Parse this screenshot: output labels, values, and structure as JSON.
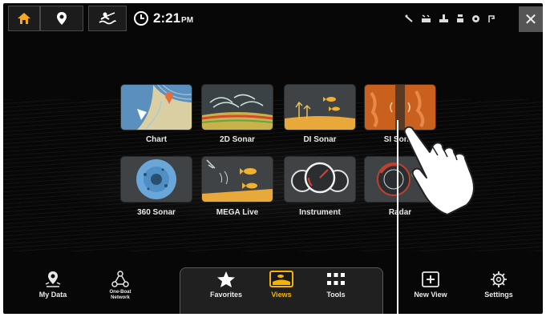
{
  "topbar": {
    "home_icon": "home-icon",
    "pin_icon": "map-pin-icon",
    "fish_icon": "fishing-person-icon",
    "time": "2:21",
    "ampm": "PM",
    "status_icons": [
      "gps-icon",
      "battery-icon",
      "water-temp-icon",
      "sonar-icon",
      "record-icon",
      "nmea-icon"
    ],
    "close_label": "✕"
  },
  "views": [
    {
      "label": "Chart"
    },
    {
      "label": "2D Sonar"
    },
    {
      "label": "DI Sonar"
    },
    {
      "label": "SI Sonar"
    },
    {
      "label": "360 Sonar"
    },
    {
      "label": "MEGA Live"
    },
    {
      "label": "Instrument"
    },
    {
      "label": "Radar"
    }
  ],
  "bottom_nav": {
    "my_data": "My Data",
    "one_boat_line1": "One-Boat",
    "one_boat_line2": "Network",
    "favorites": "Favorites",
    "views": "Views",
    "tools": "Tools",
    "new_view": "New View",
    "settings": "Settings"
  },
  "colors": {
    "accent": "#f5b400",
    "background": "#070707"
  }
}
